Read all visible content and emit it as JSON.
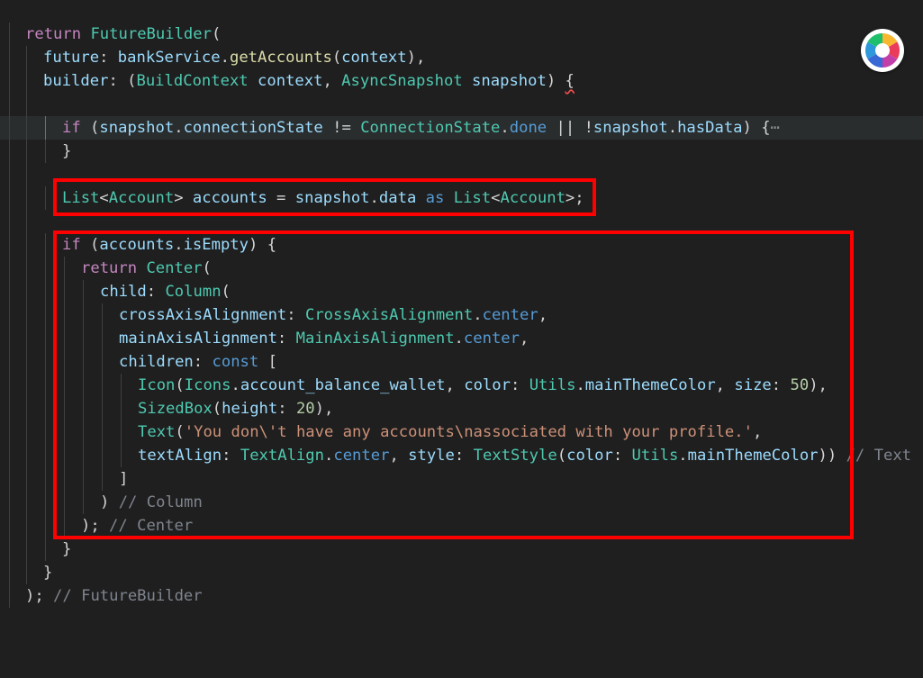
{
  "code": {
    "l1_return": "return",
    "l1_class": "FutureBuilder",
    "l1_paren": "(",
    "l2_prop": "future",
    "l2_colon": ": ",
    "l2_obj": "bankService",
    "l2_dot": ".",
    "l2_fn": "getAccounts",
    "l2_open": "(",
    "l2_arg": "context",
    "l2_close": "),",
    "l3_prop": "builder",
    "l3_colon": ": (",
    "l3_type1": "BuildContext",
    "l3_var1": " context",
    "l3_comma": ", ",
    "l3_type2": "AsyncSnapshot",
    "l3_var2": " snapshot",
    "l3_close": ") ",
    "l3_brace": "{",
    "l4_if": "if",
    "l4_open": " (",
    "l4_var": "snapshot",
    "l4_dot1": ".",
    "l4_prop": "connectionState",
    "l4_neq": " != ",
    "l4_cls": "ConnectionState",
    "l4_dot2": ".",
    "l4_done": "done",
    "l4_or": " || !",
    "l4_var2": "snapshot",
    "l4_dot3": ".",
    "l4_prop2": "hasData",
    "l4_close": ") {",
    "l4_fold": "⋯",
    "l5_brace": "}",
    "l6_type": "List",
    "l6_lt": "<",
    "l6_acc": "Account",
    "l6_gt": "> ",
    "l6_var": "accounts",
    "l6_eq": " = ",
    "l6_snap": "snapshot",
    "l6_dot": ".",
    "l6_data": "data",
    "l6_as": " as ",
    "l6_type2": "List",
    "l6_lt2": "<",
    "l6_acc2": "Account",
    "l6_end": ">;",
    "l7_if": "if",
    "l7_open": " (",
    "l7_var": "accounts",
    "l7_dot": ".",
    "l7_prop": "isEmpty",
    "l7_close": ") {",
    "l8_return": "return",
    "l8_cls": " Center",
    "l8_paren": "(",
    "l9_prop": "child",
    "l9_colon": ": ",
    "l9_cls": "Column",
    "l9_paren": "(",
    "l10_prop": "crossAxisAlignment",
    "l10_colon": ": ",
    "l10_cls": "CrossAxisAlignment",
    "l10_dot": ".",
    "l10_val": "center",
    "l10_comma": ",",
    "l11_prop": "mainAxisAlignment",
    "l11_colon": ": ",
    "l11_cls": "MainAxisAlignment",
    "l11_dot": ".",
    "l11_val": "center",
    "l11_comma": ",",
    "l12_prop": "children",
    "l12_colon": ": ",
    "l12_const": "const",
    "l12_bracket": " [",
    "l13_cls": "Icon",
    "l13_open": "(",
    "l13_icons": "Icons",
    "l13_dot": ".",
    "l13_icon": "account_balance_wallet",
    "l13_c1": ", ",
    "l13_color": "color",
    "l13_colon1": ": ",
    "l13_utils": "Utils",
    "l13_dot2": ".",
    "l13_theme": "mainThemeColor",
    "l13_c2": ", ",
    "l13_size": "size",
    "l13_colon2": ": ",
    "l13_num": "50",
    "l13_close": "),",
    "l14_cls": "SizedBox",
    "l14_open": "(",
    "l14_prop": "height",
    "l14_colon": ": ",
    "l14_num": "20",
    "l14_close": "),",
    "l15_cls": "Text",
    "l15_open": "(",
    "l15_str": "'You don\\'t have any accounts\\nassociated with your profile.'",
    "l15_comma": ",",
    "l16_prop": "textAlign",
    "l16_colon": ": ",
    "l16_cls": "TextAlign",
    "l16_dot": ".",
    "l16_val": "center",
    "l16_c": ", ",
    "l16_style": "style",
    "l16_colon2": ": ",
    "l16_ts": "TextStyle",
    "l16_open": "(",
    "l16_color": "color",
    "l16_colon3": ": ",
    "l16_utils": "Utils",
    "l16_dot2": ".",
    "l16_theme": "mainThemeColor",
    "l16_close": "))",
    "l16_comment": " // Text",
    "l17_bracket": "]",
    "l18_close": ") ",
    "l18_comment": "// Column",
    "l19_close": "); ",
    "l19_comment": "// Center",
    "l20_brace": "}",
    "l21_brace": "}",
    "l22_close": "); ",
    "l22_comment": "// FutureBuilder"
  },
  "logo": {
    "icon": "color-wheel-icon"
  }
}
